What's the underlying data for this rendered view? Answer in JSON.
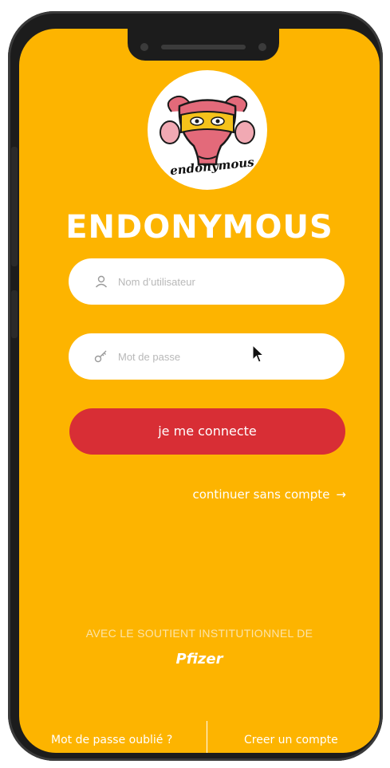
{
  "app": {
    "logo_text": "endonymous",
    "title": "ENDONYMOUS"
  },
  "form": {
    "username_placeholder": "Nom d’utilisateur",
    "username_icon": "user-icon",
    "password_placeholder": "Mot de passe",
    "password_icon": "key-icon",
    "login_label": "je me connecte"
  },
  "guest": {
    "label": "continuer sans compte",
    "icon": "arrow-right-icon"
  },
  "sponsor": {
    "caption": "AVEC LE SOUTIENT INSTITUTIONNEL DE",
    "name": "Pfizer"
  },
  "footer": {
    "forgot_password": "Mot de passe oublié ?",
    "create_account": "Creer un compte"
  },
  "colors": {
    "background": "#FDB400",
    "button": "#D82E35",
    "text": "#FFFFFF"
  }
}
